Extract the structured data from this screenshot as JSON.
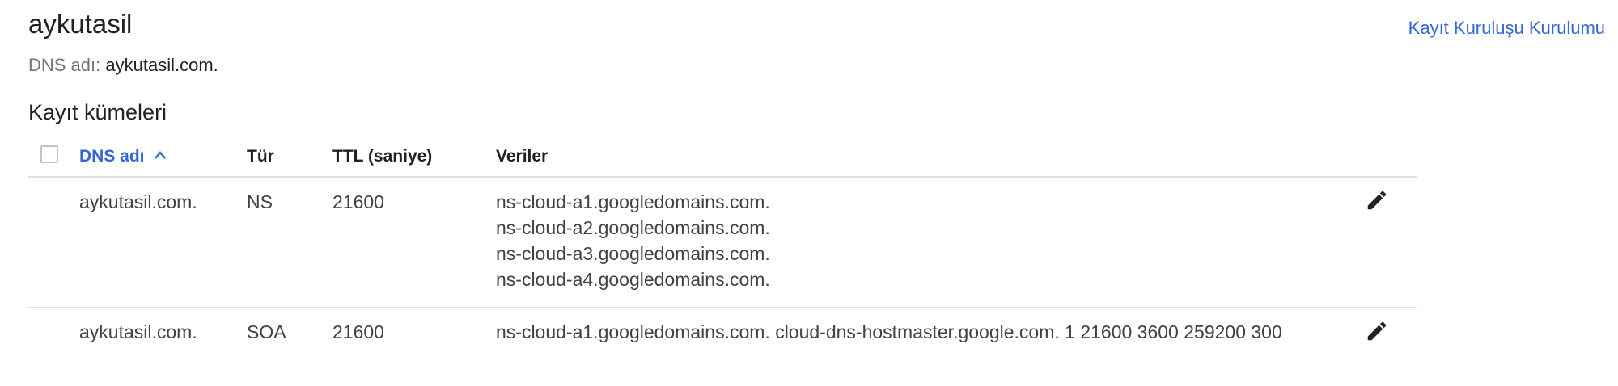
{
  "zone": {
    "title": "aykutasil",
    "dns_name_label": "DNS adı:",
    "dns_name_value": "aykutasil.com."
  },
  "header": {
    "setup_link": "Kayıt Kuruluşu Kurulumu"
  },
  "records_section": {
    "title": "Kayıt kümeleri"
  },
  "table": {
    "columns": {
      "dns_name": "DNS adı",
      "type": "Tür",
      "ttl": "TTL (saniye)",
      "data": "Veriler"
    },
    "sorted_column": "dns_name",
    "sort_direction": "ascending",
    "rows": [
      {
        "dns_name": "aykutasil.com.",
        "type": "NS",
        "ttl": "21600",
        "data": [
          "ns-cloud-a1.googledomains.com.",
          "ns-cloud-a2.googledomains.com.",
          "ns-cloud-a3.googledomains.com.",
          "ns-cloud-a4.googledomains.com."
        ]
      },
      {
        "dns_name": "aykutasil.com.",
        "type": "SOA",
        "ttl": "21600",
        "data": [
          "ns-cloud-a1.googledomains.com. cloud-dns-hostmaster.google.com. 1 21600 3600 259200 300"
        ]
      }
    ]
  },
  "icons": {
    "sort": "chevron-up-icon",
    "edit": "pencil-icon"
  },
  "colors": {
    "accent": "#3367d6",
    "text": "#212121",
    "muted": "#757575",
    "divider": "#e0e0e0"
  }
}
